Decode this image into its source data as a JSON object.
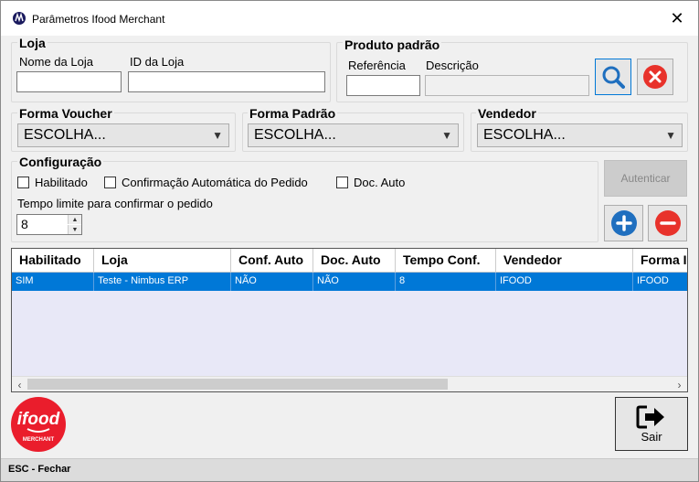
{
  "window": {
    "title": "Parâmetros Ifood Merchant",
    "close_symbol": "✕"
  },
  "loja": {
    "group_label": "Loja",
    "nome_label": "Nome da Loja",
    "nome_value": "",
    "id_label": "ID da Loja",
    "id_value": ""
  },
  "produto": {
    "group_label": "Produto padrão",
    "referencia_label": "Referência",
    "referencia_value": "",
    "descricao_label": "Descrição",
    "descricao_value": ""
  },
  "forma_voucher": {
    "label": "Forma Voucher",
    "selected": "ESCOLHA..."
  },
  "forma_padrao": {
    "label": "Forma Padrão",
    "selected": "ESCOLHA..."
  },
  "vendedor": {
    "label": "Vendedor",
    "selected": "ESCOLHA..."
  },
  "configuracao": {
    "group_label": "Configuração",
    "habilitado_label": "Habilitado",
    "confirmacao_label": "Confirmação Automática do Pedido",
    "doc_auto_label": "Doc. Auto",
    "tempo_label": "Tempo limite para confirmar o pedido",
    "tempo_value": "8"
  },
  "autenticar_label": "Autenticar",
  "grid": {
    "columns": [
      "Habilitado",
      "Loja",
      "Conf. Auto",
      "Doc. Auto",
      "Tempo Conf.",
      "Vendedor",
      "Forma I"
    ],
    "rows": [
      [
        "SIM",
        "Teste - Nimbus ERP",
        "NÃO",
        "NÃO",
        "8",
        "IFOOD",
        "IFOOD"
      ]
    ]
  },
  "logo": {
    "brand": "ifood",
    "sub": "MERCHANT"
  },
  "sair_label": "Sair",
  "status_text": "ESC - Fechar",
  "colors": {
    "accent": "#0078d7",
    "ifood_red": "#ea1d2c",
    "add_blue": "#1f6fbf",
    "remove_red": "#e8322b"
  }
}
